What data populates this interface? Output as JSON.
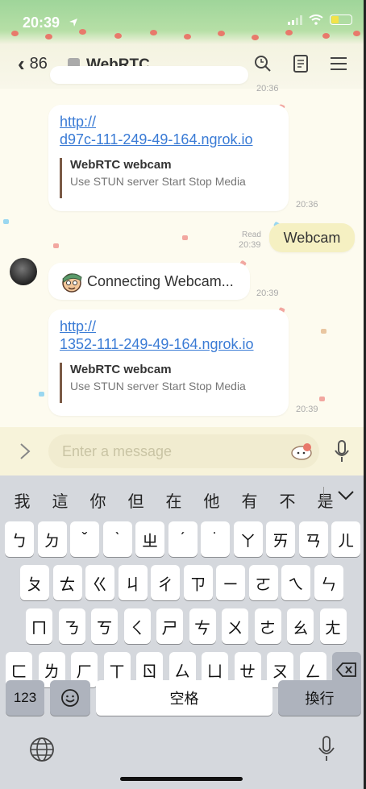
{
  "status": {
    "time": "20:39",
    "signal": "signal-bars-icon",
    "wifi": "wifi-icon",
    "battery": "battery-icon",
    "location": "location-arrow-icon"
  },
  "nav": {
    "back_count": "86",
    "title": "WebRTC",
    "icons": [
      "search-icon",
      "notes-icon",
      "menu-icon"
    ]
  },
  "messages": [
    {
      "type": "link",
      "url_line1": "http://",
      "url_line2": "d97c-111-249-49-164.ngrok.io",
      "preview_title": "WebRTC webcam",
      "preview_desc": "Use STUN server Start Stop Media",
      "time": "20:36"
    },
    {
      "type": "outgoing",
      "text": "Webcam",
      "read": "Read",
      "time": "20:39"
    },
    {
      "type": "incoming",
      "text": "Connecting Webcam...",
      "time": "20:39"
    },
    {
      "type": "link",
      "url_line1": "http://",
      "url_line2": "1352-111-249-49-164.ngrok.io",
      "preview_title": "WebRTC webcam",
      "preview_desc": "Use STUN server Start Stop Media",
      "time": "20:39"
    }
  ],
  "top_partial_time": "20:36",
  "composer": {
    "placeholder": "Enter a message"
  },
  "keyboard": {
    "candidates": [
      "我",
      "這",
      "你",
      "但",
      "在",
      "他",
      "有",
      "不",
      "是"
    ],
    "row1": [
      "ㄅ",
      "ㄉ",
      "ˇ",
      "ˋ",
      "ㄓ",
      "ˊ",
      "˙",
      "ㄚ",
      "ㄞ",
      "ㄢ",
      "ㄦ"
    ],
    "row2": [
      "ㄆ",
      "ㄊ",
      "ㄍ",
      "ㄐ",
      "ㄔ",
      "ㄗ",
      "ㄧ",
      "ㄛ",
      "ㄟ",
      "ㄣ"
    ],
    "row3": [
      "ㄇ",
      "ㄋ",
      "ㄎ",
      "ㄑ",
      "ㄕ",
      "ㄘ",
      "ㄨ",
      "ㄜ",
      "ㄠ",
      "ㄤ"
    ],
    "row4": [
      "ㄈ",
      "ㄌ",
      "ㄏ",
      "ㄒ",
      "ㄖ",
      "ㄙ",
      "ㄩ",
      "ㄝ",
      "ㄡ",
      "ㄥ"
    ],
    "numbers": "123",
    "space": "空格",
    "return": "換行"
  }
}
